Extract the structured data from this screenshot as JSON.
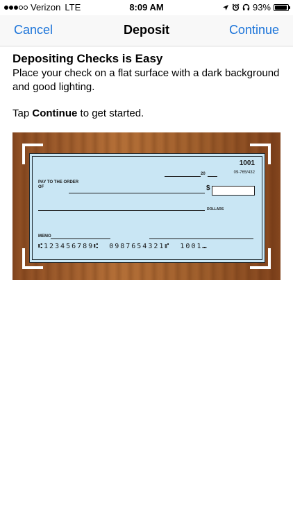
{
  "status_bar": {
    "carrier": "Verizon",
    "network": "LTE",
    "time": "8:09 AM",
    "battery": "93%",
    "battery_level": 0.93,
    "signal_strength": 3,
    "icons": [
      "location-arrow-icon",
      "alarm-clock-icon",
      "headphones-icon",
      "battery-icon"
    ]
  },
  "nav": {
    "cancel_label": "Cancel",
    "title": "Deposit",
    "continue_label": "Continue"
  },
  "content": {
    "heading": "Depositing Checks is Easy",
    "description": "Place your check on a flat surface with a dark background and good lighting.",
    "tap_prefix": "Tap ",
    "tap_bold": "Continue",
    "tap_suffix": " to get started."
  },
  "check": {
    "number": "1001",
    "routing_code": "09-765/432",
    "year_prefix": "20",
    "pay_label": "PAY TO THE ORDER OF",
    "dollar_sign": "$",
    "dollars_label": "DOLLARS",
    "memo_label": "MEMO",
    "micr_routing": "⑆123456789⑆",
    "micr_account": "0987654321⑈",
    "micr_check": "1001⑉"
  },
  "colors": {
    "accent": "#1a73d9",
    "check_paper": "#c9e6f4",
    "wood": "#a0602d"
  }
}
